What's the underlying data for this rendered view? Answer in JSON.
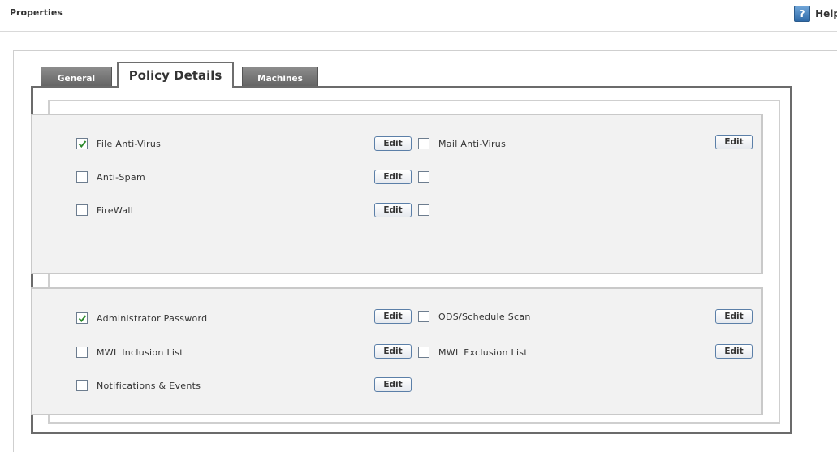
{
  "header": {
    "title": "Properties",
    "help_label": "Help",
    "help_icon": "help-icon"
  },
  "tabs": [
    {
      "label": "General",
      "active": false
    },
    {
      "label": "Policy Details",
      "active": true
    },
    {
      "label": "Machines",
      "active": false
    }
  ],
  "protection": {
    "items": [
      {
        "label": "File Anti-Virus",
        "checked": true,
        "edit_label": "Edit"
      },
      {
        "label": "Mail Anti-Virus",
        "checked": false,
        "edit_label": "Edit"
      },
      {
        "label": "Anti-Spam",
        "checked": false,
        "edit_label": "Edit"
      },
      {
        "label": "",
        "checked": false
      },
      {
        "label": "FireWall",
        "checked": false,
        "edit_label": "Edit"
      },
      {
        "label": "",
        "checked": false
      }
    ]
  },
  "settings": {
    "items": [
      {
        "label": "Administrator Password",
        "checked": true,
        "edit_label": "Edit"
      },
      {
        "label": "ODS/Schedule Scan",
        "checked": false,
        "edit_label": "Edit"
      },
      {
        "label": "MWL Inclusion List",
        "checked": false,
        "edit_label": "Edit"
      },
      {
        "label": "MWL Exclusion List",
        "checked": false,
        "edit_label": "Edit"
      },
      {
        "label": "Notifications & Events",
        "checked": false,
        "edit_label": "Edit"
      }
    ]
  },
  "colors": {
    "checkmark": "#2e8b2e",
    "tab_inactive": "#6e6e6e",
    "section_bg": "#f2f2f2",
    "button_border": "#5b7fa8"
  }
}
